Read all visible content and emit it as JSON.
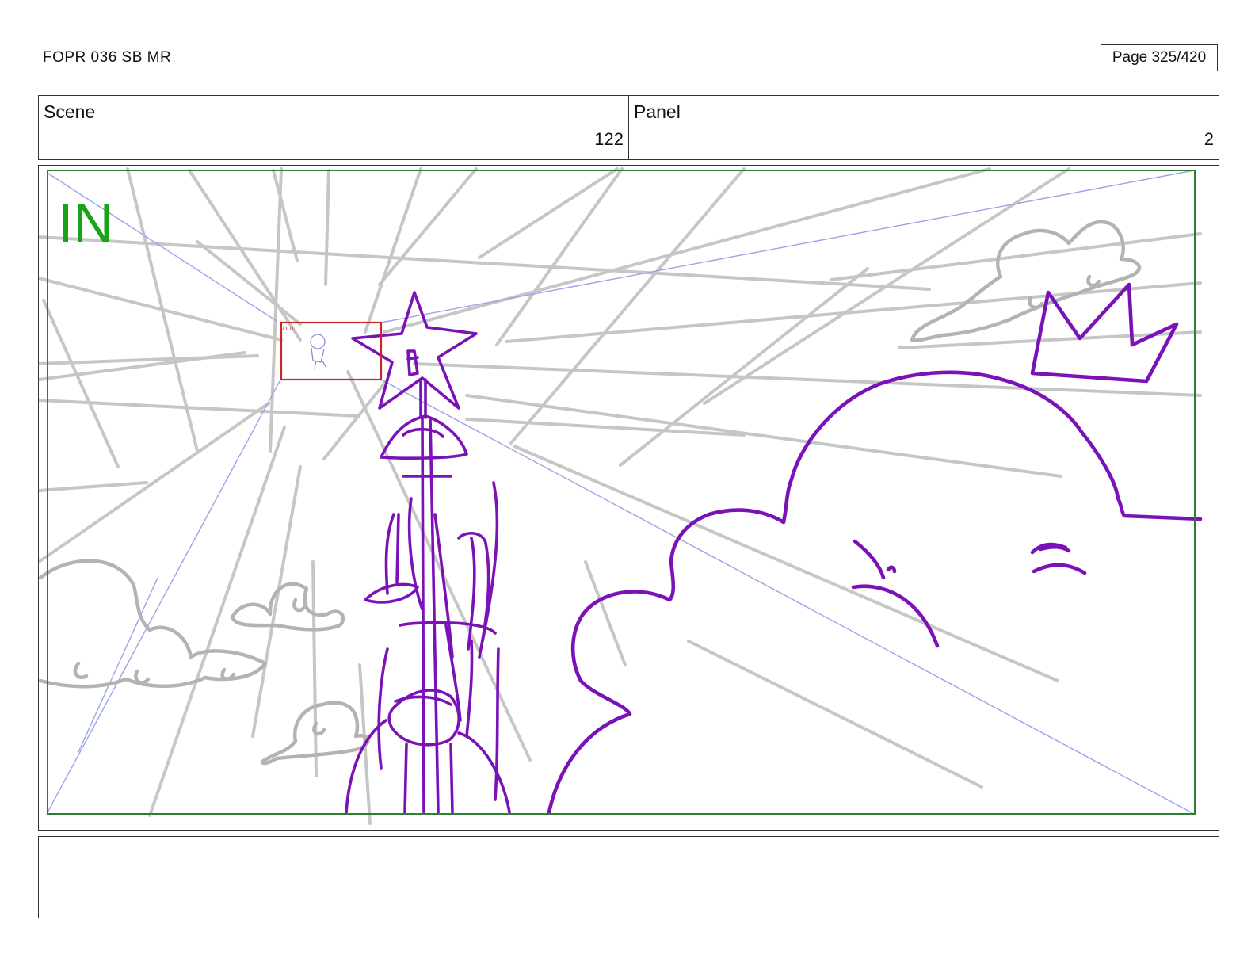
{
  "header": {
    "doc_title": "FOPR 036 SB MR",
    "page_label": "Page 325/420"
  },
  "scene": {
    "label": "Scene",
    "value": "122"
  },
  "panel": {
    "label": "Panel",
    "value": "2"
  },
  "artwork": {
    "overlay_text": "IN",
    "field_box_text": "OUT",
    "colors": {
      "frame_green": "#2e7d32",
      "in_text_green": "#19a319",
      "sketch_purple": "#7a12b8",
      "guide_gray": "#c4c4c4",
      "perspective_blue": "#9aa3e8",
      "field_box_red": "#c62828"
    }
  },
  "notes": {
    "text": ""
  }
}
